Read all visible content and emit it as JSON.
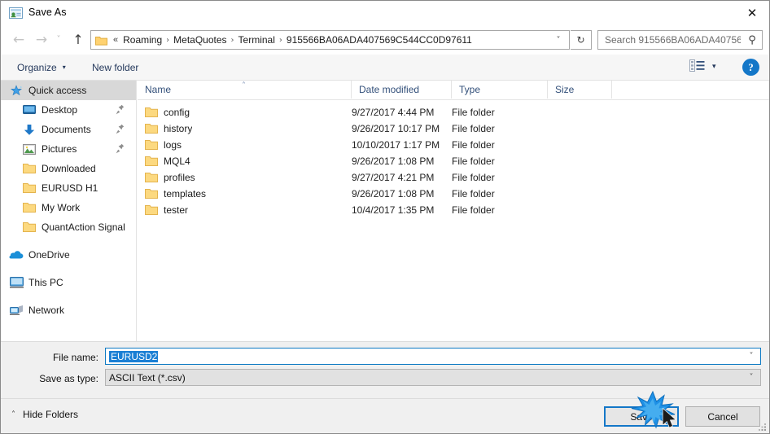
{
  "window": {
    "title": "Save As",
    "icon": "save-as-icon",
    "close_label": "✕"
  },
  "nav": {
    "back_icon": "←",
    "forward_icon": "→",
    "recent_icon": "˅",
    "up_icon": "↑",
    "refresh_icon": "↻",
    "dropdown_icon": "˅",
    "breadcrumb_first": "«",
    "separator": "›",
    "breadcrumbs": [
      "Roaming",
      "MetaQuotes",
      "Terminal",
      "915566BA06ADA407569C544CC0D97611"
    ]
  },
  "search": {
    "placeholder": "Search 915566BA06ADA40756...",
    "value": "",
    "icon": "⚲"
  },
  "commandbar": {
    "organize": "Organize",
    "new_folder": "New folder",
    "caret": "▾",
    "view_caret": "▾",
    "help": "?"
  },
  "sidebar": {
    "items": [
      {
        "label": "Quick access",
        "icon": "star-icon",
        "level": 0,
        "selected": true,
        "pinned": false
      },
      {
        "label": "Desktop",
        "icon": "monitor-icon",
        "level": 1,
        "selected": false,
        "pinned": true
      },
      {
        "label": "Documents",
        "icon": "download-arrow-icon",
        "level": 1,
        "selected": false,
        "pinned": true
      },
      {
        "label": "Pictures",
        "icon": "picture-icon",
        "level": 1,
        "selected": false,
        "pinned": true
      },
      {
        "label": "Downloaded",
        "icon": "folder-icon",
        "level": 1,
        "selected": false,
        "pinned": false
      },
      {
        "label": "EURUSD H1",
        "icon": "folder-icon",
        "level": 1,
        "selected": false,
        "pinned": false
      },
      {
        "label": "My Work",
        "icon": "folder-icon",
        "level": 1,
        "selected": false,
        "pinned": false
      },
      {
        "label": "QuantAction Signal",
        "icon": "folder-icon",
        "level": 1,
        "selected": false,
        "pinned": false
      },
      {
        "label": "OneDrive",
        "icon": "cloud-icon",
        "level": 0,
        "selected": false,
        "pinned": false,
        "gap_before": true
      },
      {
        "label": "This PC",
        "icon": "pc-icon",
        "level": 0,
        "selected": false,
        "pinned": false,
        "gap_before": true
      },
      {
        "label": "Network",
        "icon": "network-icon",
        "level": 0,
        "selected": false,
        "pinned": false,
        "gap_before": true
      }
    ]
  },
  "filelist": {
    "columns": [
      "Name",
      "Date modified",
      "Type",
      "Size"
    ],
    "sort_caret": "˄",
    "rows": [
      {
        "name": "config",
        "date": "9/27/2017 4:44 PM",
        "type": "File folder",
        "size": ""
      },
      {
        "name": "history",
        "date": "9/26/2017 10:17 PM",
        "type": "File folder",
        "size": ""
      },
      {
        "name": "logs",
        "date": "10/10/2017 1:17 PM",
        "type": "File folder",
        "size": ""
      },
      {
        "name": "MQL4",
        "date": "9/26/2017 1:08 PM",
        "type": "File folder",
        "size": ""
      },
      {
        "name": "profiles",
        "date": "9/27/2017 4:21 PM",
        "type": "File folder",
        "size": ""
      },
      {
        "name": "templates",
        "date": "9/26/2017 1:08 PM",
        "type": "File folder",
        "size": ""
      },
      {
        "name": "tester",
        "date": "10/4/2017 1:35 PM",
        "type": "File folder",
        "size": ""
      }
    ]
  },
  "form": {
    "filename_label": "File name:",
    "filename_value": "EURUSD2",
    "filetype_label": "Save as type:",
    "filetype_value": "ASCII Text (*.csv)",
    "arrow": "˅"
  },
  "footer": {
    "hide_folders": "Hide Folders",
    "hide_caret": "˄",
    "save": "Save",
    "cancel": "Cancel"
  },
  "colors": {
    "accent": "#1477c8",
    "selection": "#1a7fd4",
    "folder": "#ffd270",
    "header_text": "#33507a",
    "chrome": "#f0f0f0"
  }
}
